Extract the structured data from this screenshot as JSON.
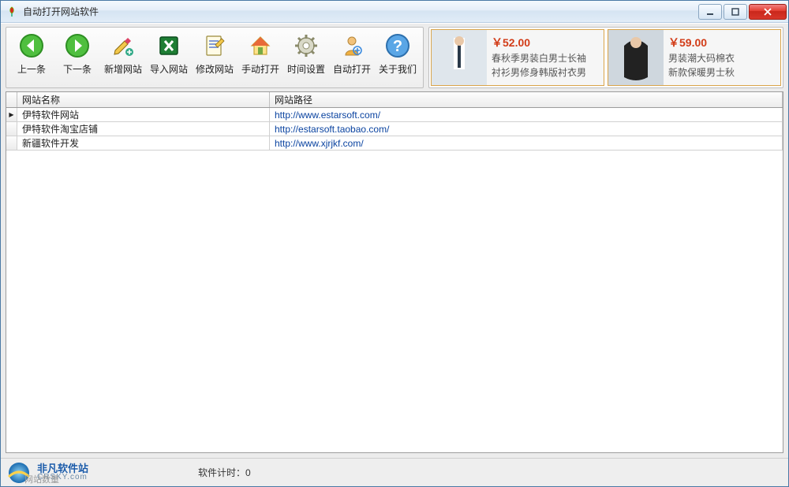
{
  "window": {
    "title": "自动打开网站软件"
  },
  "toolbar": {
    "prev": {
      "label": "上一条"
    },
    "next": {
      "label": "下一条"
    },
    "add": {
      "label": "新增网站"
    },
    "import": {
      "label": "导入网站"
    },
    "edit": {
      "label": "修改网站"
    },
    "manual": {
      "label": "手动打开"
    },
    "time": {
      "label": "时间设置"
    },
    "auto": {
      "label": "自动打开"
    },
    "about": {
      "label": "关于我们"
    }
  },
  "ads": [
    {
      "price": "￥52.00",
      "desc1": "春秋季男装白男士长袖",
      "desc2": "衬衫男修身韩版衬衣男"
    },
    {
      "price": "￥59.00",
      "desc1": "男装潮大码棉衣",
      "desc2": "新款保暖男士秋"
    }
  ],
  "grid": {
    "headers": {
      "name": "网站名称",
      "url": "网站路径"
    },
    "rows": [
      {
        "current": true,
        "name": "伊特软件网站",
        "url": "http://www.estarsoft.com/"
      },
      {
        "current": false,
        "name": "伊特软件淘宝店铺",
        "url": "http://estarsoft.taobao.com/"
      },
      {
        "current": false,
        "name": "新疆软件开发",
        "url": "http://www.xjrjkf.com/"
      }
    ]
  },
  "status": {
    "logo_cn": "非凡软件站",
    "logo_en": "CRSKY.com",
    "count_label": "网站数量",
    "timer_label": "软件计时：",
    "timer_value": "0"
  }
}
